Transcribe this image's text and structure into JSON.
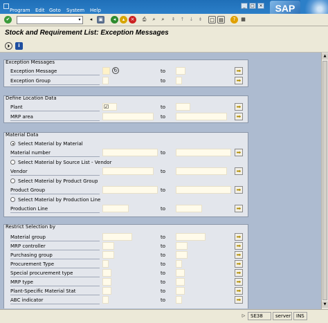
{
  "menubar": {
    "items": [
      "Program",
      "Edit",
      "Goto",
      "System",
      "Help"
    ],
    "logo": "SAP"
  },
  "toolbar": {
    "icons": [
      "enter-icon",
      "save-icon",
      "back-icon",
      "exit-icon",
      "cancel-icon",
      "print-icon",
      "find-icon",
      "find-next-icon",
      "first-page-icon",
      "previous-page-icon",
      "next-page-icon",
      "last-page-icon",
      "new-session-icon",
      "shortcut-icon",
      "help-icon",
      "layout-icon"
    ]
  },
  "title": "Stock and Requirement List: Exception Messages",
  "groups": {
    "exception": {
      "title": "Exception Messages",
      "rows": [
        {
          "label": "Exception Message",
          "to": "to"
        },
        {
          "label": "Exception Group",
          "to": "to"
        }
      ]
    },
    "location": {
      "title": "Define Location Data",
      "rows": [
        {
          "label": "Plant",
          "value": "☑",
          "to": "to"
        },
        {
          "label": "MRP area",
          "to": "to"
        }
      ]
    },
    "material": {
      "title": "Material Data",
      "radio1": "Select Material by Material",
      "label1": "Material number",
      "radio2": "Select Material by Source List - Vendor",
      "label2": "Vendor",
      "radio3": "Select Material by Product Group",
      "label3": "Product Group",
      "radio4": "Select Material by Production Line",
      "label4": "Production Line",
      "to": "to"
    },
    "restrict": {
      "title": "Restrict Selection by",
      "rows": [
        {
          "label": "Material group",
          "to": "to"
        },
        {
          "label": "MRP controller",
          "to": "to"
        },
        {
          "label": "Purchasing group",
          "to": "to"
        },
        {
          "label": "Procurement Type",
          "to": "to"
        },
        {
          "label": "Special procurement type",
          "to": "to"
        },
        {
          "label": "MRP type",
          "to": "to"
        },
        {
          "label": "Plant-Specific Material Stat",
          "to": "to"
        },
        {
          "label": "ABC indicator",
          "to": "to"
        }
      ]
    }
  },
  "statusbar": {
    "transaction": "SE38",
    "server": "server",
    "mode": "INS"
  },
  "colors": {
    "menubar": "#2c7fc8",
    "content_bg": "#adbbd0",
    "input_bg": "#fffbea",
    "multiple_selection_arrow": "#b08c00"
  }
}
